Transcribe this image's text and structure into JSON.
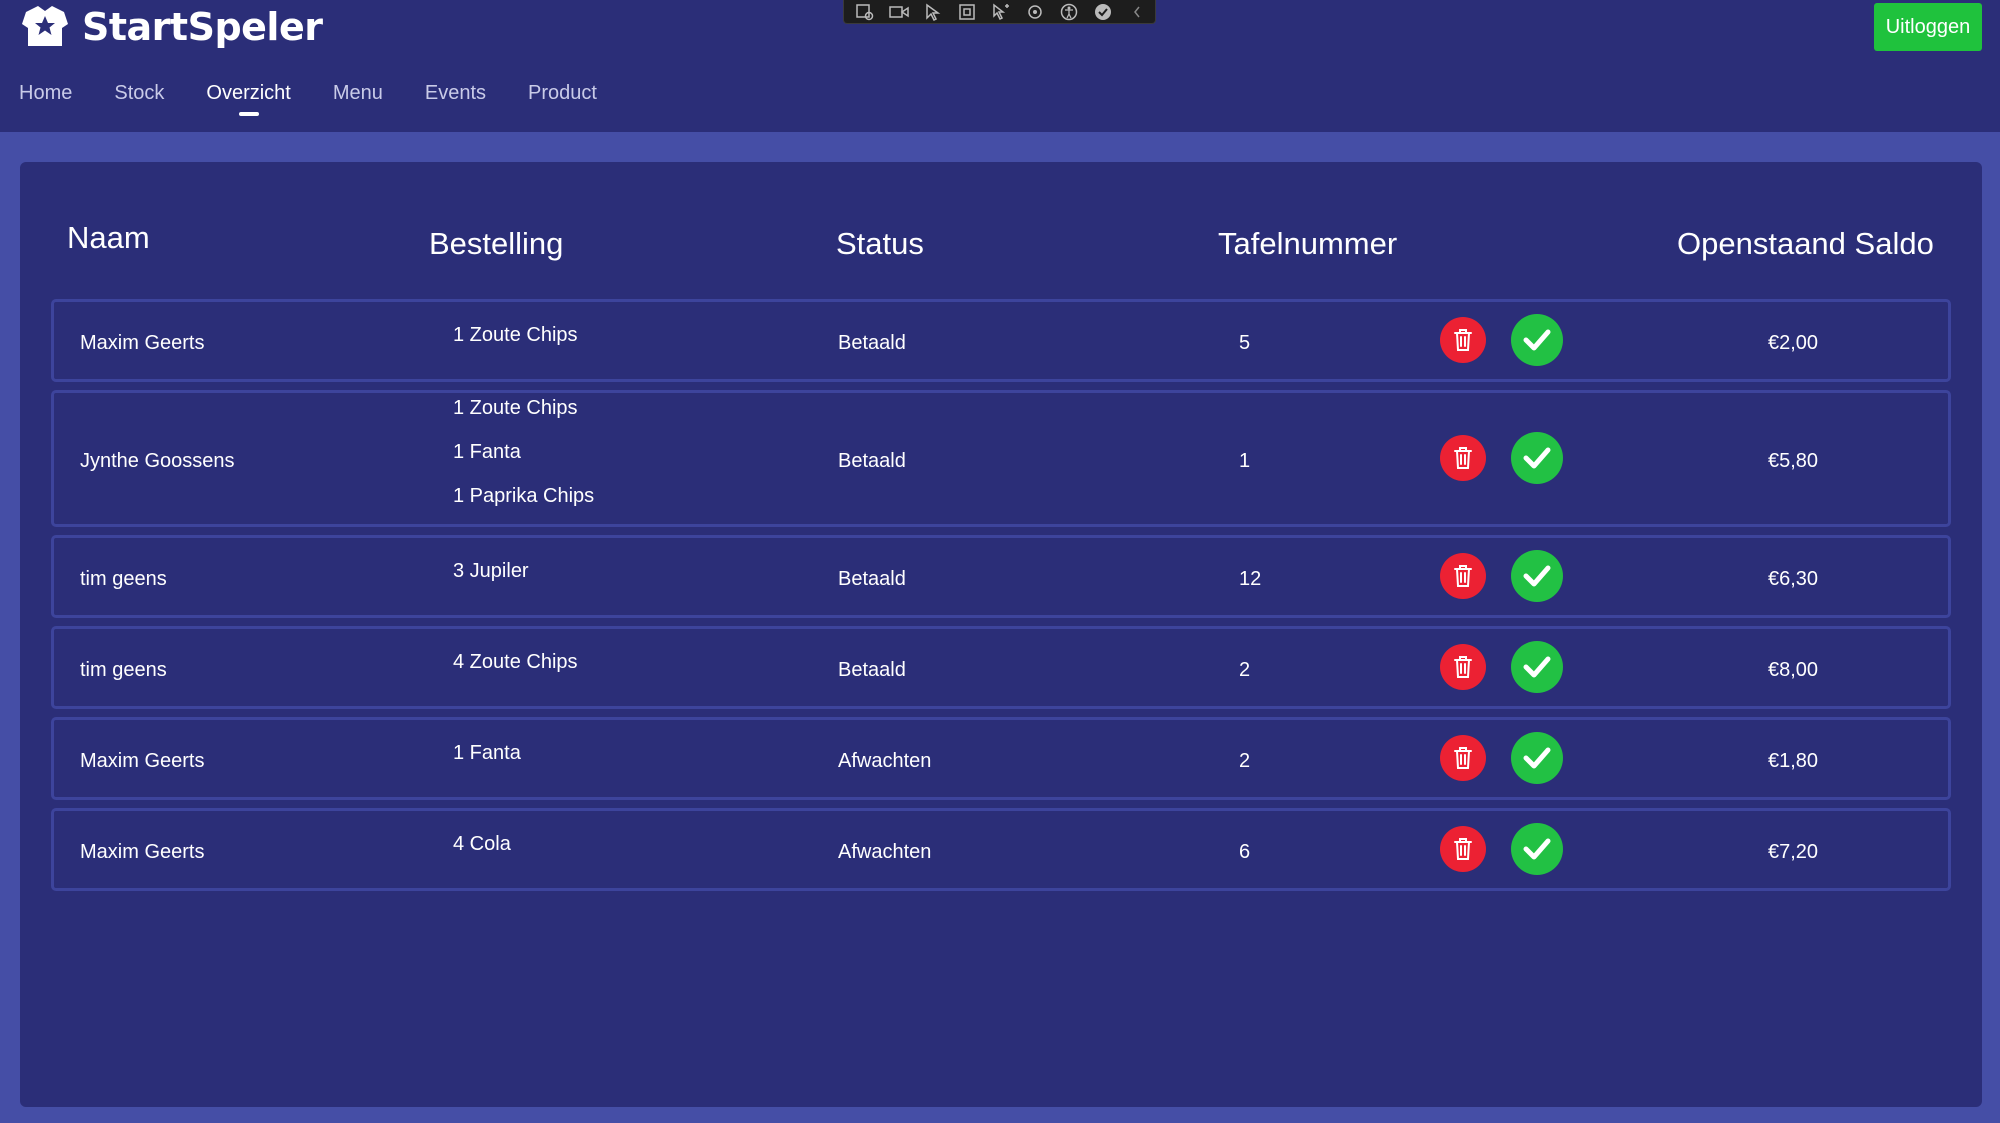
{
  "app": {
    "brand_name": "StartSpeler",
    "logout_label": "Uitloggen"
  },
  "nav": {
    "items": [
      {
        "label": "Home",
        "active": false
      },
      {
        "label": "Stock",
        "active": false
      },
      {
        "label": "Overzicht",
        "active": true
      },
      {
        "label": "Menu",
        "active": false
      },
      {
        "label": "Events",
        "active": false
      },
      {
        "label": "Product",
        "active": false
      }
    ]
  },
  "dev_toolbar": {
    "icons": [
      "inspect-icon",
      "record-icon",
      "select-icon",
      "layout-icon",
      "pointer-icon",
      "settings-icon",
      "accessibility-icon",
      "check-icon",
      "chevron-left-icon"
    ]
  },
  "table": {
    "headers": {
      "name": "Naam",
      "order": "Bestelling",
      "status": "Status",
      "table_number": "Tafelnummer",
      "balance": "Openstaand Saldo"
    },
    "rows": [
      {
        "name": "Maxim Geerts",
        "order": [
          "1 Zoute Chips"
        ],
        "status": "Betaald",
        "table_number": "5",
        "balance": "€2,00"
      },
      {
        "name": "Jynthe Goossens",
        "order": [
          "1 Zoute Chips",
          "1 Fanta",
          "1 Paprika Chips"
        ],
        "status": "Betaald",
        "table_number": "1",
        "balance": "€5,80"
      },
      {
        "name": "tim geens",
        "order": [
          "3 Jupiler"
        ],
        "status": "Betaald",
        "table_number": "12",
        "balance": "€6,30"
      },
      {
        "name": "tim geens",
        "order": [
          "4 Zoute Chips"
        ],
        "status": "Betaald",
        "table_number": "2",
        "balance": "€8,00"
      },
      {
        "name": "Maxim Geerts",
        "order": [
          "1 Fanta"
        ],
        "status": "Afwachten",
        "table_number": "2",
        "balance": "€1,80"
      },
      {
        "name": "Maxim Geerts",
        "order": [
          "4 Cola"
        ],
        "status": "Afwachten",
        "table_number": "6",
        "balance": "€7,20"
      }
    ]
  },
  "colors": {
    "page_bg": "#454ea6",
    "panel_bg": "#2b2e78",
    "delete_red": "#ec2133",
    "confirm_green": "#22c144",
    "logout_green": "#1fc23d"
  }
}
